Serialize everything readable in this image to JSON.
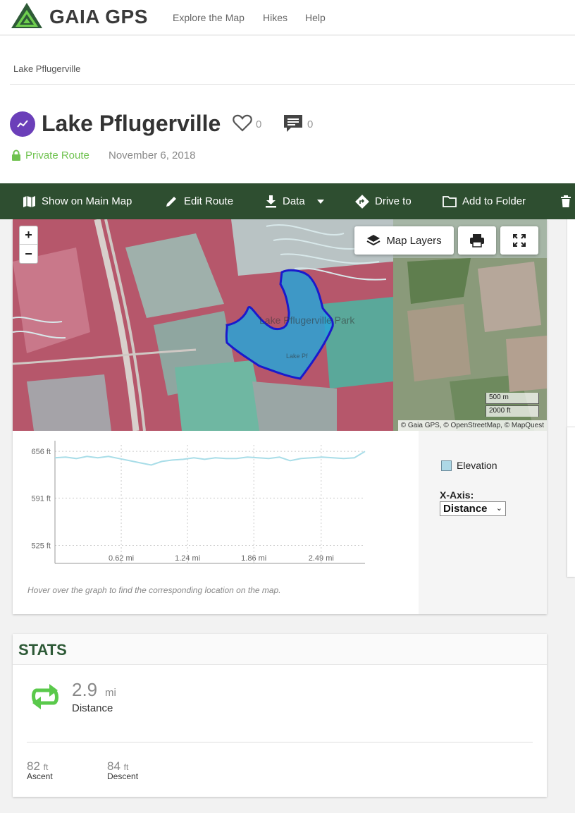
{
  "nav": {
    "brand": "GAIA GPS",
    "links": [
      "Explore the Map",
      "Hikes",
      "Help"
    ]
  },
  "breadcrumb": "Lake Pflugerville",
  "route": {
    "title": "Lake Pflugerville",
    "likes": "0",
    "comments": "0",
    "privacy": "Private Route",
    "date": "November 6, 2018"
  },
  "toolbar": {
    "show_on_map": "Show on Main Map",
    "edit_route": "Edit Route",
    "data": "Data",
    "drive_to": "Drive to",
    "add_to_folder": "Add to Folder"
  },
  "map": {
    "zoom_in": "+",
    "zoom_out": "−",
    "layers_label": "Map Layers",
    "park_label": "Lake Pflugerville Park",
    "lake_label": "Lake Pf",
    "scale_metric": "500 m",
    "scale_imperial": "2000 ft",
    "attribution": "© Gaia GPS, © OpenStreetMap, © MapQuest",
    "route_color": "#1a1acc",
    "fill_color": "#29a3d6"
  },
  "chart_data": {
    "type": "line",
    "series": [
      {
        "name": "Elevation",
        "x": [
          0,
          0.1,
          0.2,
          0.3,
          0.4,
          0.5,
          0.6,
          0.7,
          0.8,
          0.9,
          1.0,
          1.1,
          1.2,
          1.3,
          1.4,
          1.5,
          1.6,
          1.7,
          1.8,
          1.9,
          2.0,
          2.1,
          2.2,
          2.3,
          2.4,
          2.5,
          2.6,
          2.7,
          2.8,
          2.9
        ],
        "y": [
          647,
          648,
          646,
          649,
          647,
          649,
          646,
          643,
          640,
          637,
          642,
          644,
          645,
          647,
          645,
          647,
          646,
          646,
          648,
          647,
          646,
          648,
          643,
          646,
          647,
          648,
          647,
          646,
          647,
          656
        ]
      }
    ],
    "yticks": [
      "656 ft",
      "591 ft",
      "525 ft"
    ],
    "ytick_values": [
      656,
      591,
      525
    ],
    "xticks": [
      "0.62 mi",
      "1.24 mi",
      "1.86 mi",
      "2.49 mi"
    ],
    "xtick_values": [
      0.62,
      1.24,
      1.86,
      2.49
    ],
    "xlim": [
      0,
      2.9
    ],
    "ylim": [
      500,
      665
    ],
    "color": "#a8dde8",
    "grid": true,
    "legend": "right"
  },
  "chart_side": {
    "legend_label": "Elevation",
    "xaxis_label": "X-Axis:",
    "xaxis_value": "Distance"
  },
  "hover_hint": "Hover over the graph to find the corresponding location on the map.",
  "stats": {
    "title": "STATS",
    "distance_value": "2.9",
    "distance_unit": "mi",
    "distance_label": "Distance",
    "ascent_value": "82",
    "ascent_unit": "ft",
    "ascent_label": "Ascent",
    "descent_value": "84",
    "descent_unit": "ft",
    "descent_label": "Descent"
  }
}
